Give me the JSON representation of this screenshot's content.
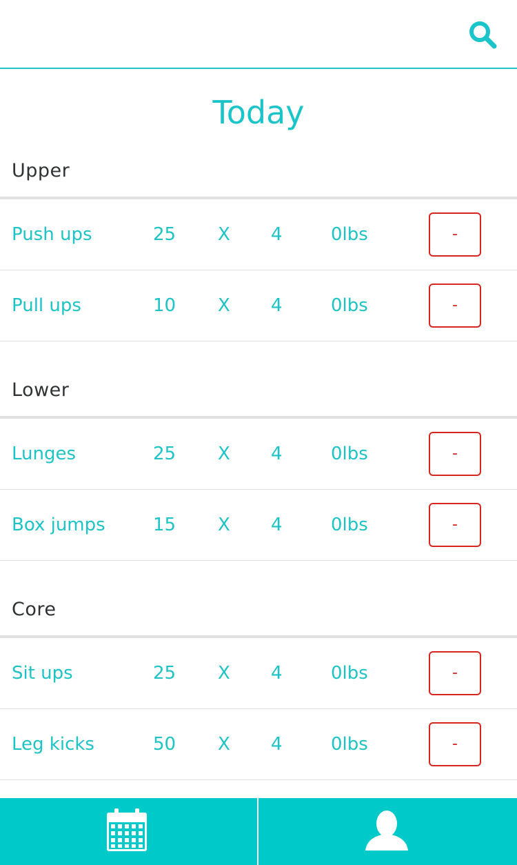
{
  "header": {
    "search_icon": "search-icon"
  },
  "page_title": "Today",
  "multiplier_symbol": "X",
  "remove_label": "-",
  "sections": [
    {
      "title": "Upper",
      "exercises": [
        {
          "name": "Push ups",
          "reps": "25",
          "sets": "4",
          "weight": "0lbs"
        },
        {
          "name": "Pull ups",
          "reps": "10",
          "sets": "4",
          "weight": "0lbs"
        }
      ]
    },
    {
      "title": "Lower",
      "exercises": [
        {
          "name": "Lunges",
          "reps": "25",
          "sets": "4",
          "weight": "0lbs"
        },
        {
          "name": "Box jumps",
          "reps": "15",
          "sets": "4",
          "weight": "0lbs"
        }
      ]
    },
    {
      "title": "Core",
      "exercises": [
        {
          "name": "Sit ups",
          "reps": "25",
          "sets": "4",
          "weight": "0lbs"
        },
        {
          "name": "Leg kicks",
          "reps": "50",
          "sets": "4",
          "weight": "0lbs"
        }
      ]
    }
  ],
  "tab_bar": {
    "tabs": [
      {
        "icon": "calendar-icon"
      },
      {
        "icon": "user-icon"
      }
    ]
  },
  "colors": {
    "accent": "#1ec3c6",
    "tab_bar": "#00c9ca",
    "remove": "#d9251f",
    "section_title": "#2f3133"
  }
}
